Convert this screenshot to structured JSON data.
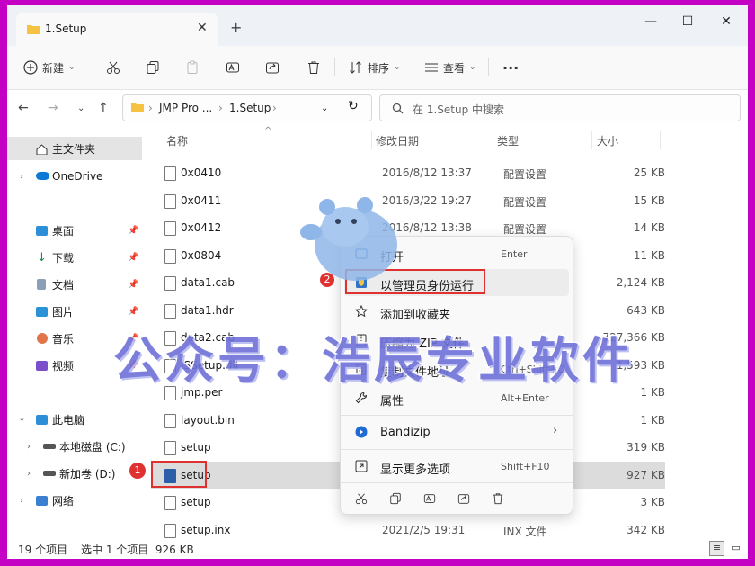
{
  "window": {
    "tab_title": "1.Setup",
    "tab_close": "✕",
    "new_tab": "+",
    "minimize": "—",
    "maximize": "☐",
    "close": "✕"
  },
  "toolbar": {
    "new_label": "新建",
    "sort_label": "排序",
    "view_label": "查看",
    "more": "···"
  },
  "address": {
    "crumbs": [
      "JMP Pro ...",
      "1.Setup"
    ],
    "search_placeholder": "在 1.Setup 中搜索"
  },
  "nav": {
    "home": "主文件夹",
    "onedrive": "OneDrive",
    "quick": [
      {
        "label": "桌面"
      },
      {
        "label": "下载"
      },
      {
        "label": "文档"
      },
      {
        "label": "图片"
      },
      {
        "label": "音乐"
      },
      {
        "label": "视频"
      }
    ],
    "this_pc": "此电脑",
    "drive_c": "本地磁盘 (C:)",
    "drive_d": "新加卷 (D:)",
    "network": "网络"
  },
  "columns": {
    "name": "名称",
    "date": "修改日期",
    "type": "类型",
    "size": "大小"
  },
  "files": [
    {
      "name": "0x0410",
      "date": "2016/8/12 13:37",
      "type": "配置设置",
      "size": "25 KB"
    },
    {
      "name": "0x0411",
      "date": "2016/3/22 19:27",
      "type": "配置设置",
      "size": "15 KB"
    },
    {
      "name": "0x0412",
      "date": "2016/8/12 13:38",
      "type": "配置设置",
      "size": "14 KB"
    },
    {
      "name": "0x0804",
      "date": "",
      "type": "",
      "size": "11 KB"
    },
    {
      "name": "data1.cab",
      "date": "",
      "type": "",
      "size": "2,124 KB"
    },
    {
      "name": "data1.hdr",
      "date": "",
      "type": "",
      "size": "643 KB"
    },
    {
      "name": "data2.cab",
      "date": "",
      "type": "",
      "size": "727,366 KB"
    },
    {
      "name": "ISSetup.dll",
      "date": "",
      "type": "",
      "size": "1,593 KB"
    },
    {
      "name": "jmp.per",
      "date": "",
      "type": "",
      "size": "1 KB"
    },
    {
      "name": "layout.bin",
      "date": "",
      "type": "",
      "size": "1 KB"
    },
    {
      "name": "setup",
      "date": "",
      "type": "",
      "size": "319 KB"
    },
    {
      "name": "setup",
      "date": "",
      "type": "",
      "size": "927 KB"
    },
    {
      "name": "setup",
      "date": "",
      "type": "",
      "size": "3 KB"
    },
    {
      "name": "setup.inx",
      "date": "2021/2/5 19:31",
      "type": "INX 文件",
      "size": "342 KB"
    }
  ],
  "selected_row": 11,
  "context_menu": {
    "items": [
      {
        "label": "打开",
        "shortcut": "Enter"
      },
      {
        "label": "以管理员身份运行",
        "shortcut": ""
      },
      {
        "label": "添加到收藏夹",
        "shortcut": ""
      },
      {
        "label": "压缩为 ZIP 文件",
        "shortcut": ""
      },
      {
        "label": "复制文件地址",
        "shortcut": "Ctrl+Shift+C"
      },
      {
        "label": "属性",
        "shortcut": "Alt+Enter"
      },
      {
        "label": "Bandizip",
        "shortcut": ""
      },
      {
        "label": "显示更多选项",
        "shortcut": "Shift+F10"
      }
    ]
  },
  "annotations": {
    "badge1": "1",
    "badge2": "2"
  },
  "watermark": "公众号：浩辰专业软件",
  "status": {
    "count": "19 个项目",
    "selection": "选中 1 个项目  926 KB"
  },
  "colors": {
    "accent": "#0067c0",
    "frame": "#c400c4",
    "highlight": "#e03131",
    "selected_row": "#dcdcdc"
  }
}
